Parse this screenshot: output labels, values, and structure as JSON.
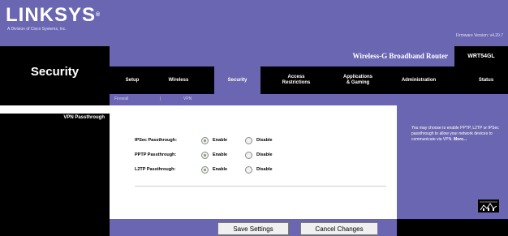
{
  "brand": {
    "logo": "LINKSYS",
    "tagline": "A Division of Cisco Systems, Inc.",
    "firmware": "Firmware Version: v4.20.7"
  },
  "page": {
    "title": "Security"
  },
  "product": {
    "name": "Wireless-G Broadband Router",
    "model": "WRT54GL"
  },
  "tabs": [
    {
      "label": "Setup"
    },
    {
      "label": "Wireless"
    },
    {
      "label": "Security",
      "active": true
    },
    {
      "label": "Access\nRestrictions"
    },
    {
      "label": "Applications\n& Gaming"
    },
    {
      "label": "Administration"
    },
    {
      "label": "Status"
    }
  ],
  "subtabs": [
    "Firewall",
    "VPN"
  ],
  "section": {
    "label": "VPN Passthrough"
  },
  "options": [
    {
      "label": "IPSec Passthrough:",
      "enable": "Enable",
      "disable": "Disable",
      "value": "enable"
    },
    {
      "label": "PPTP Passthrough:",
      "enable": "Enable",
      "disable": "Disable",
      "value": "enable"
    },
    {
      "label": "L2TP Passthrough:",
      "enable": "Enable",
      "disable": "Disable",
      "value": "enable"
    }
  ],
  "buttons": {
    "save": "Save Settings",
    "cancel": "Cancel Changes"
  },
  "help": {
    "text": "You may choose to enable PPTP, L2TP or IPSec passthrough to allow your network devices to communicate via VPN.",
    "more": "More..."
  },
  "colors": {
    "brand_purple": "#6a66b2",
    "dark": "#000000"
  },
  "icons": {
    "cisco": "cisco-systems-logo-icon"
  }
}
